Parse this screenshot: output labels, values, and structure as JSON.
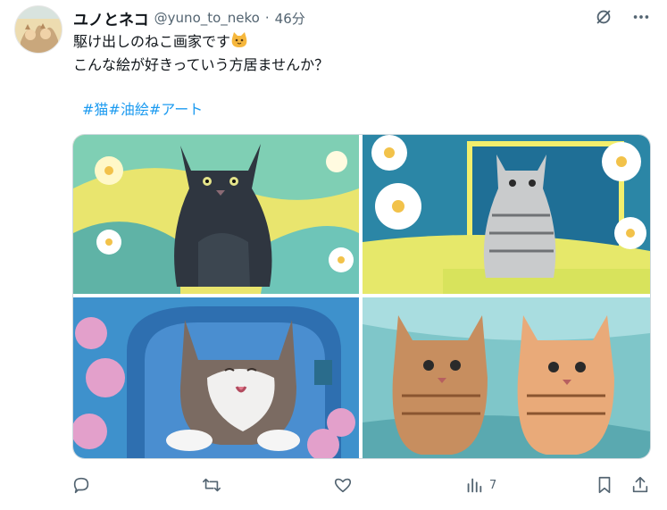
{
  "post": {
    "display_name": "ユノとネコ",
    "handle": "@yuno_to_neko",
    "separator": "·",
    "time": "46分",
    "line1": "駆け出しのねこ画家です",
    "line2": "こんな絵が好きっていう方居ませんか？",
    "hashtags": [
      "#猫",
      "#油絵",
      "#アート"
    ]
  },
  "media": {
    "images": [
      {
        "subject": "black cat in yellow-blue garden",
        "palette": [
          "#f2e96b",
          "#6cc5b0",
          "#2e3440"
        ]
      },
      {
        "subject": "tabby cat by blue window with daisies",
        "palette": [
          "#2a86a8",
          "#f4f06a",
          "#cfd3d6"
        ]
      },
      {
        "subject": "tabby and white cat in window with lilacs",
        "palette": [
          "#3b8fcf",
          "#e6a3c8",
          "#7a6a60"
        ]
      },
      {
        "subject": "two orange tabby kittens",
        "palette": [
          "#7fc4c9",
          "#e3a47c",
          "#c77f54"
        ]
      }
    ]
  },
  "actions": {
    "reply": {
      "icon": "reply-icon"
    },
    "repost": {
      "icon": "repost-icon"
    },
    "like": {
      "icon": "heart-icon"
    },
    "views": {
      "icon": "views-icon",
      "count": "7"
    },
    "bookmark": {
      "icon": "bookmark-icon"
    },
    "share": {
      "icon": "share-icon"
    }
  },
  "colors": {
    "text": "#0f1419",
    "muted": "#536471",
    "link": "#1d9bf0",
    "border": "#cfd9de"
  }
}
